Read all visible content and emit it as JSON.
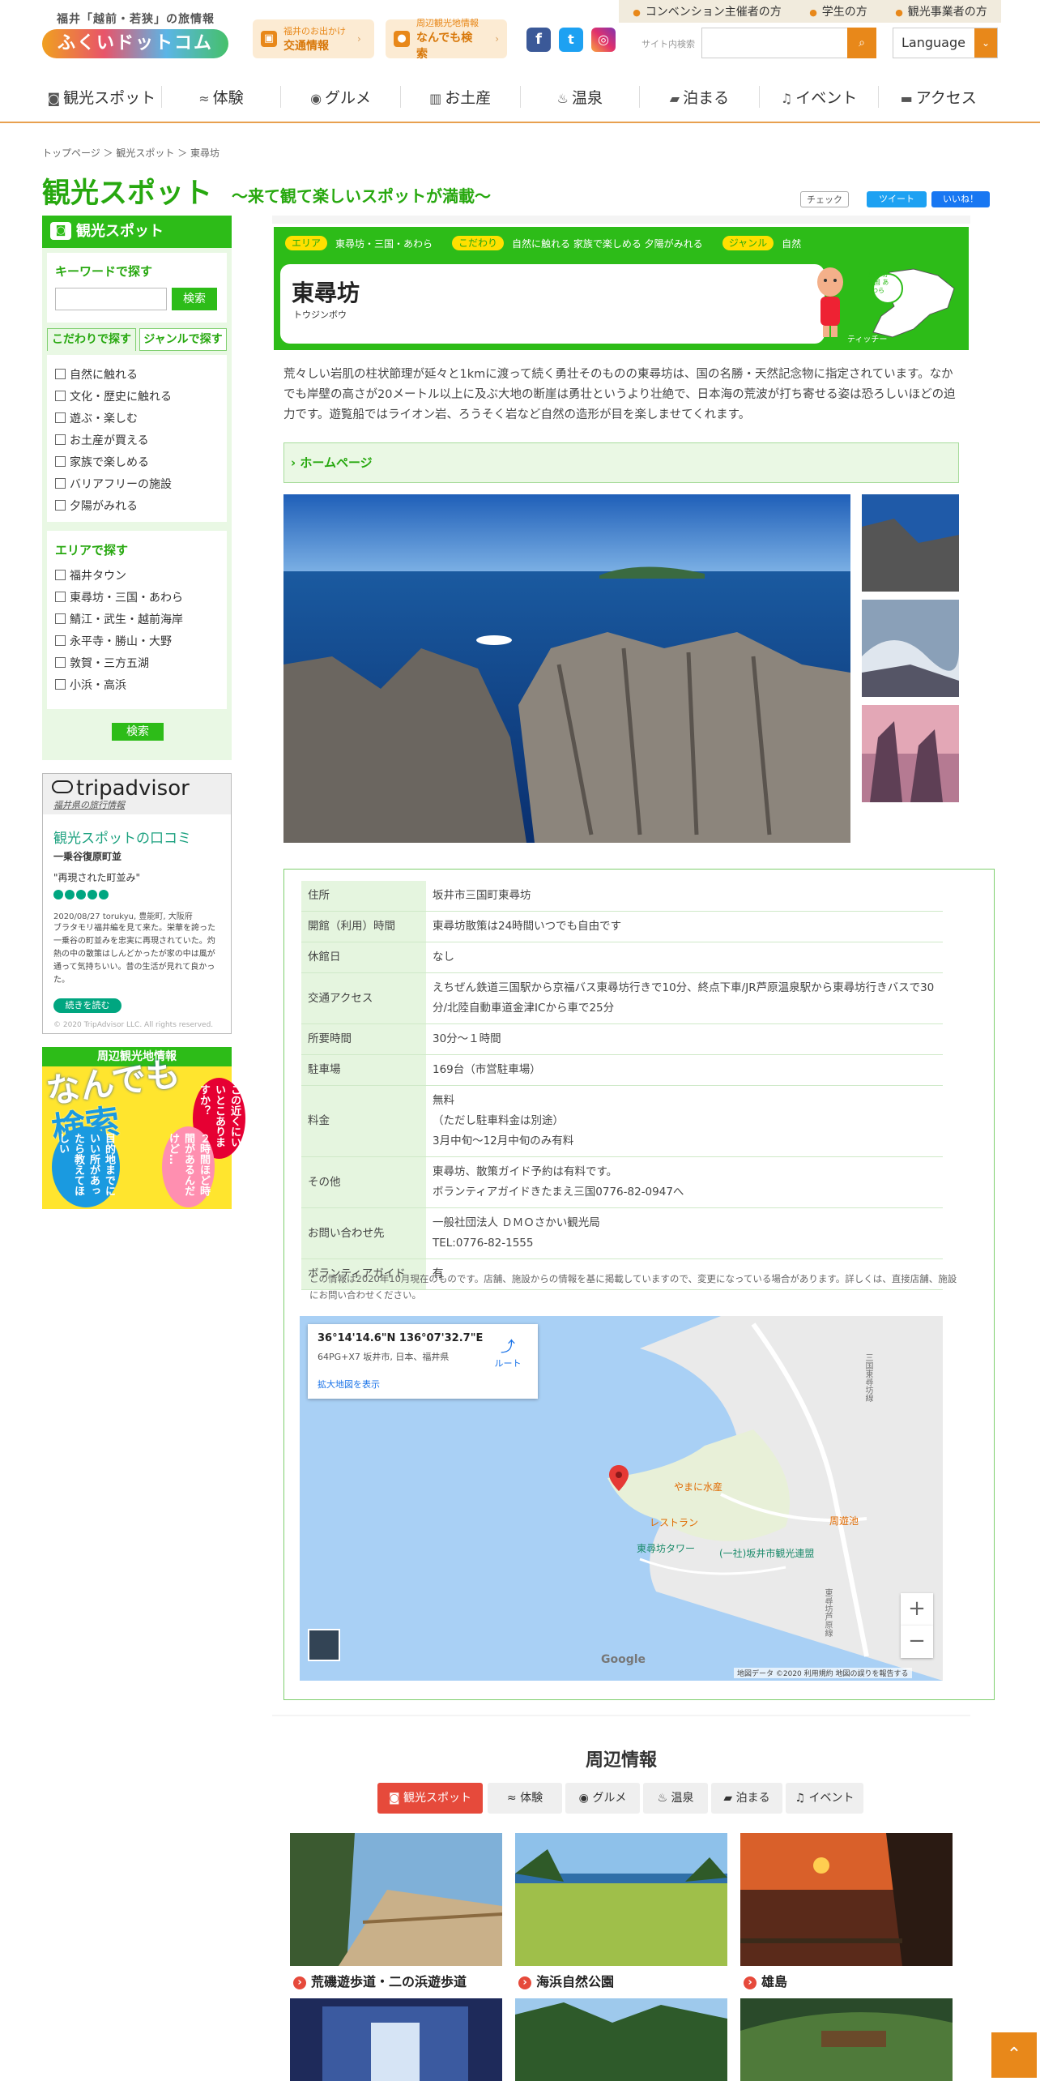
{
  "header": {
    "logo_sub": "福井「越前・若狭」の旅情報",
    "logo_main": "ふくいドットコム",
    "btn_traffic_small": "福井のお出かけ",
    "btn_traffic": "交通情報",
    "btn_search_small": "周辺観光地情報",
    "btn_search": "なんでも検索",
    "toplinks": [
      "コンベンション主催者の方",
      "学生の方",
      "観光事業者の方"
    ],
    "search_label": "サイト内検索",
    "language": "Language"
  },
  "nav": [
    "観光スポット",
    "体験",
    "グルメ",
    "お土産",
    "温泉",
    "泊まる",
    "イベント",
    "アクセス"
  ],
  "breadcrumb": "トップページ ＞ 観光スポット ＞ 東尋坊",
  "page_title": "観光スポット",
  "page_subtitle": "～来て観て楽しいスポットが満載～",
  "share": {
    "check": "チェック",
    "tweet": "ツイート",
    "like": "いいね！"
  },
  "sidebar": {
    "header": "観光スポット",
    "keyword_label": "キーワードで探す",
    "search_btn": "検索",
    "tab1": "こだわりで探す",
    "tab2": "ジャンルで探す",
    "kodawari": [
      "自然に触れる",
      "文化・歴史に触れる",
      "遊ぶ・楽しむ",
      "お土産が買える",
      "家族で楽しめる",
      "バリアフリーの施設",
      "夕陽がみれる"
    ],
    "area_label": "エリアで探す",
    "areas": [
      "福井タウン",
      "東尋坊・三国・あわら",
      "鯖江・武生・越前海岸",
      "永平寺・勝山・大野",
      "敦賀・三方五湖",
      "小浜・高浜"
    ],
    "go_btn": "検索"
  },
  "tripadvisor": {
    "logo": "tripadvisor",
    "sub": "福井県の旅行情報",
    "heading": "観光スポットの口コミ",
    "spot": "一乗谷復原町並",
    "quote": "\"再現された町並み\"",
    "meta": "2020/08/27  torukyu, 豊能町, 大阪府",
    "body": "ブラタモリ福井編を見て来た。栄華を誇った一乗谷の町並みを忠実に再現されていた。灼熱の中の散策はしんどかったが家の中は風が通って気持ちいい。昔の生活が見れて良かった。",
    "more": "続きを読む",
    "copy": "© 2020 TripAdvisor LLC. All rights reserved."
  },
  "banner": {
    "header": "周辺観光地情報",
    "big1": "なんでも",
    "big2": "検索",
    "v1": "この近くにいいとこありますか？",
    "v2": "２時間ほど時間があるんだけど…",
    "v3": "目的地までにいい所があったら教えてほしい"
  },
  "spot": {
    "tag_area": "エリア",
    "area": "東尋坊・三国・あわら",
    "tag_kodawari": "こだわり",
    "kodawari": "自然に触れる 家族で楽しめる 夕陽がみれる",
    "tag_genre": "ジャンル",
    "genre": "自然",
    "name": "東尋坊",
    "kana": "トウジンボウ",
    "mascot": "ティッチー",
    "map_label": "東尋坊 三国 あわら",
    "description": "荒々しい岩肌の柱状節理が延々と1kmに渡って続く勇壮そのものの東尋坊は、国の名勝・天然記念物に指定されています。なかでも岸壁の高さが20メートル以上に及ぶ大地の断崖は勇壮というより壮絶で、日本海の荒波が打ち寄せる姿は恐ろしいほどの迫力です。遊覧船ではライオン岩、ろうそく岩など自然の造形が目を楽しませてくれます。",
    "homepage": "ホームページ"
  },
  "info": [
    {
      "k": "住所",
      "v": [
        "坂井市三国町東尋坊"
      ]
    },
    {
      "k": "開館（利用）時間",
      "v": [
        "東尋坊散策は24時間いつでも自由です"
      ]
    },
    {
      "k": "休館日",
      "v": [
        "なし"
      ]
    },
    {
      "k": "交通アクセス",
      "v": [
        "えちぜん鉄道三国駅から京福バス東尋坊行きで10分、終点下車/JR芦原温泉駅から東尋坊行きバスで30分/北陸自動車道金津ICから車で25分"
      ]
    },
    {
      "k": "所要時間",
      "v": [
        "30分～１時間"
      ]
    },
    {
      "k": "駐車場",
      "v": [
        "169台（市営駐車場）"
      ]
    },
    {
      "k": "料金",
      "v": [
        "無料",
        "（ただし駐車料金は別途）",
        "3月中旬～12月中旬のみ有料"
      ]
    },
    {
      "k": "その他",
      "v": [
        "東尋坊、散策ガイド予約は有料です。",
        "ボランティアガイドきたまえ三国0776-82-0947へ"
      ]
    },
    {
      "k": "お問い合わせ先",
      "v": [
        "一般社団法人 ＤＭＯさかい観光局",
        "TEL:0776-82-1555"
      ]
    },
    {
      "k": "ボランティアガイド",
      "v": [
        "有"
      ]
    }
  ],
  "note": "この情報は2020年10月現在のものです。店舗、施設からの情報を基に掲載していますので、変更になっている場合があります。詳しくは、直接店舗、施設にお問い合わせください。",
  "map": {
    "coords": "36°14'14.6\"N 136°07'32.7\"E",
    "plus": "64PG+X7 坂井市, 日本、福井県",
    "enlarge": "拡大地図を表示",
    "route": "ルート",
    "labels": [
      "やまに水産",
      "レストラン",
      "東尋坊タワー",
      "(一社)坂井市観光連盟",
      "周遊池",
      "三国東尋坊線",
      "東尋坊芦原線"
    ],
    "google": "Google",
    "footer": "地図データ ©2020   利用規約   地図の誤りを報告する"
  },
  "nearby": {
    "heading": "周辺情報",
    "tabs": [
      "観光スポット",
      "体験",
      "グルメ",
      "温泉",
      "泊まる",
      "イベント"
    ],
    "items": [
      "荒磯遊歩道・二の浜遊歩道",
      "海浜自然公園",
      "雄島"
    ]
  },
  "colors": {
    "green": "#2dbc18",
    "orange": "#e8881a",
    "red": "#e64a3b"
  }
}
